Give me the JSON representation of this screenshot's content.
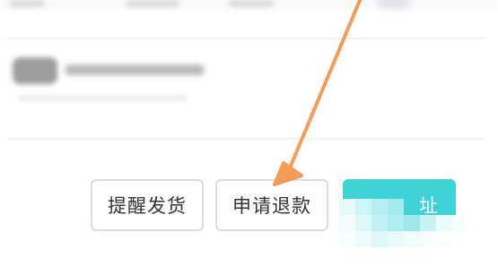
{
  "order_actions": {
    "remind_shipping_label": "提醒发货",
    "apply_refund_label": "申请退款",
    "modify_address_label": "修改地址",
    "modify_address_visible_part": "址"
  },
  "colors": {
    "primary_button": "#3fd2d6",
    "annotation_arrow": "#f59b58",
    "button_border": "#dcdcdc"
  },
  "annotation": {
    "type": "arrow",
    "points_to": "apply_refund_button"
  }
}
